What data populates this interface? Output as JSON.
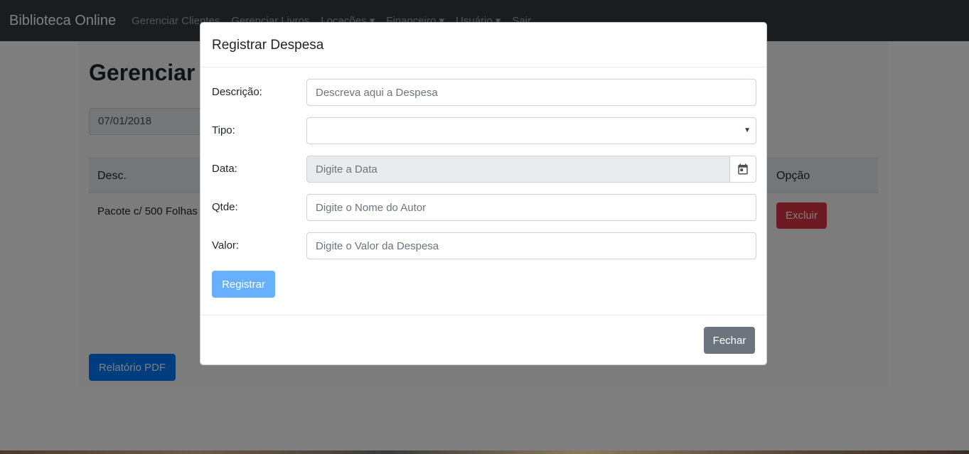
{
  "navbar": {
    "brand": "Biblioteca Online",
    "items": [
      {
        "label": "Gerenciar Clientes"
      },
      {
        "label": "Gerenciar Livros"
      },
      {
        "label": "Locações ▾"
      },
      {
        "label": "Financeiro ▾"
      },
      {
        "label": "Usuário ▾"
      },
      {
        "label": "Sair"
      }
    ]
  },
  "page": {
    "title": "Gerenciar Despesas",
    "date_filter": "07/01/2018",
    "table": {
      "headers": {
        "desc": "Desc.",
        "option": "Opção"
      },
      "rows": [
        {
          "desc": "Pacote c/ 500 Folhas",
          "action": "Excluir"
        }
      ]
    },
    "pdf_button": "Relatório PDF"
  },
  "modal": {
    "title": "Registrar Despesa",
    "fields": {
      "descricao": {
        "label": "Descrição:",
        "placeholder": "Descreva aqui a Despesa",
        "value": ""
      },
      "tipo": {
        "label": "Tipo:",
        "value": ""
      },
      "data": {
        "label": "Data:",
        "placeholder": "Digite a Data",
        "value": ""
      },
      "qtde": {
        "label": "Qtde:",
        "placeholder": "Digite o Nome do Autor",
        "value": ""
      },
      "valor": {
        "label": "Valor:",
        "placeholder": "Digite o Valor da Despesa",
        "value": ""
      }
    },
    "submit_label": "Registrar",
    "close_label": "Fechar"
  },
  "colors": {
    "navbar_bg": "#343a40",
    "primary": "#007bff",
    "primary_light": "#66b0ff",
    "danger": "#dc3545",
    "secondary": "#6c757d"
  },
  "icons": {
    "date_picker": "calendar-icon",
    "select": "caret-down-icon"
  }
}
